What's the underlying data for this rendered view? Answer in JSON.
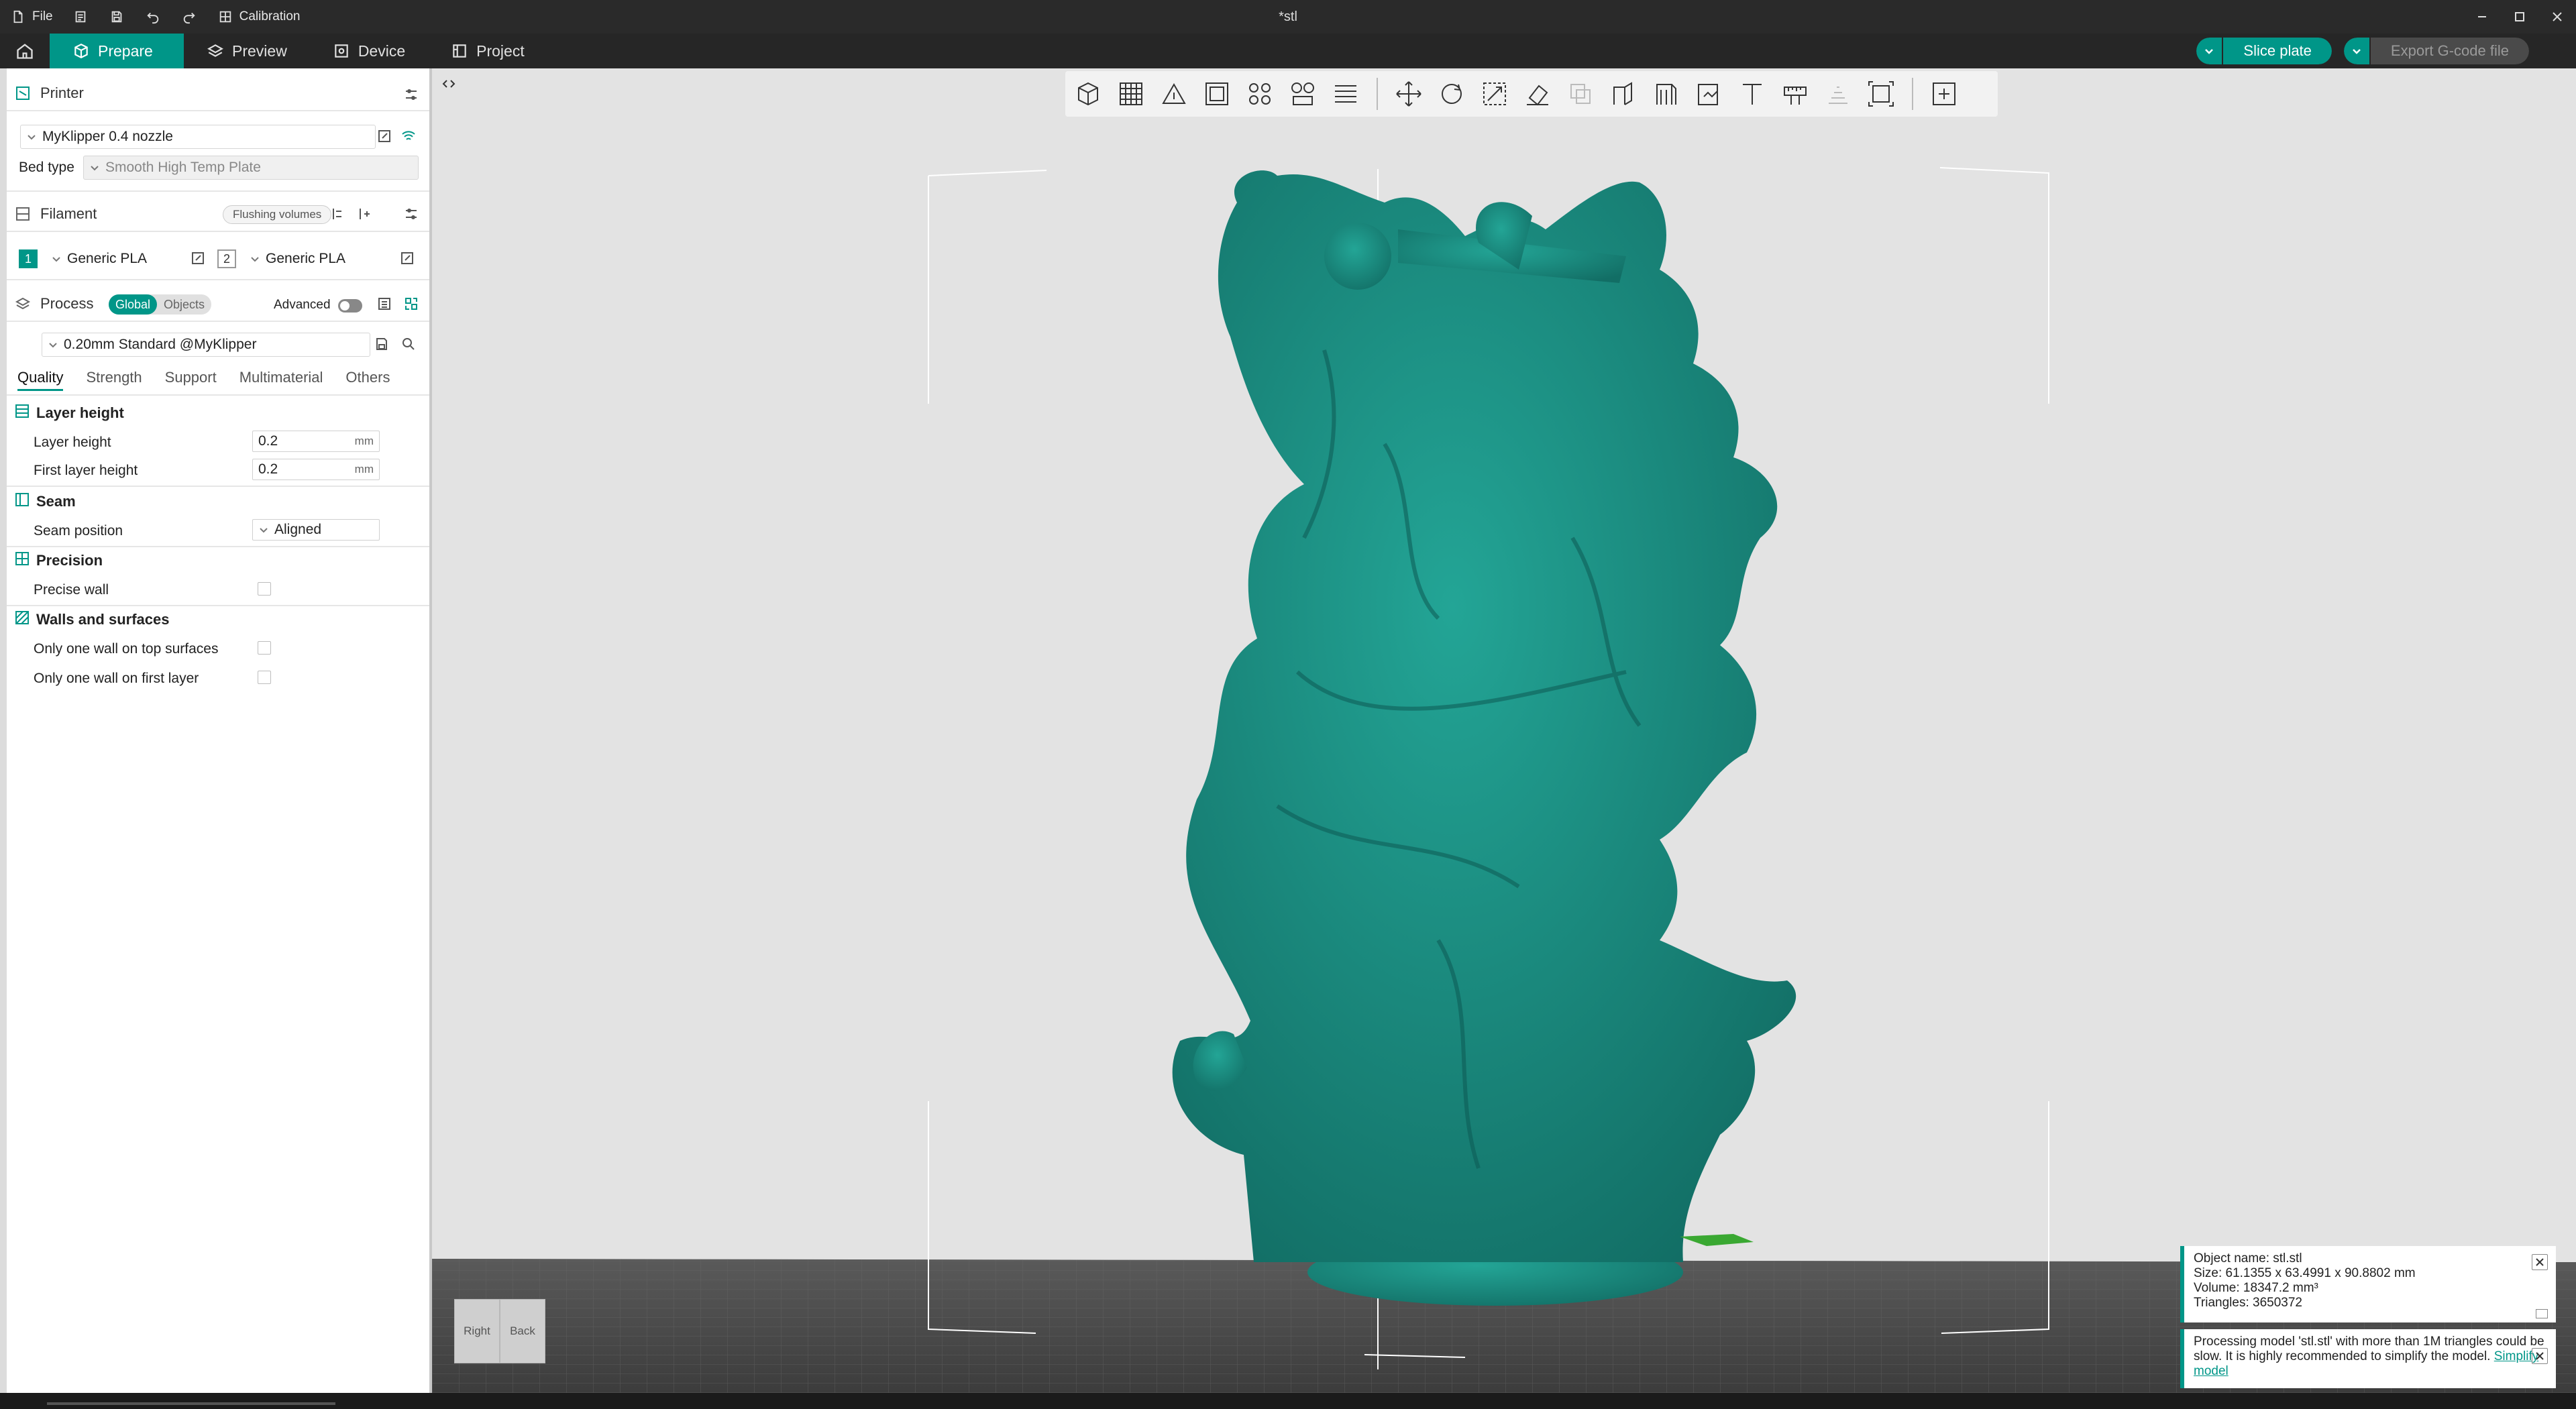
{
  "titlebar": {
    "file_label": "File",
    "calibration_label": "Calibration",
    "document_title": "*stl"
  },
  "nav": {
    "tabs": [
      {
        "label": "Prepare",
        "icon": "cube-icon",
        "active": true
      },
      {
        "label": "Preview",
        "icon": "layers-icon",
        "active": false
      },
      {
        "label": "Device",
        "icon": "device-icon",
        "active": false
      },
      {
        "label": "Project",
        "icon": "project-icon",
        "active": false
      }
    ],
    "slice_label": "Slice plate",
    "export_label": "Export G-code file"
  },
  "printer": {
    "section_label": "Printer",
    "name": "MyKlipper 0.4 nozzle",
    "bed_type_label": "Bed type",
    "bed_type_value": "Smooth High Temp Plate"
  },
  "filament": {
    "section_label": "Filament",
    "flushing_label": "Flushing volumes",
    "slots": [
      {
        "number": "1",
        "name": "Generic PLA",
        "color": "#009688"
      },
      {
        "number": "2",
        "name": "Generic PLA",
        "color": "#ffffff"
      }
    ]
  },
  "process": {
    "section_label": "Process",
    "seg_global": "Global",
    "seg_objects": "Objects",
    "advanced_label": "Advanced",
    "advanced_on": false,
    "preset": "0.20mm Standard @MyKlipper",
    "tabs": [
      "Quality",
      "Strength",
      "Support",
      "Multimaterial",
      "Others"
    ],
    "active_tab": "Quality"
  },
  "quality": {
    "layer_height_group": "Layer height",
    "layer_height_label": "Layer height",
    "layer_height_value": "0.2",
    "first_layer_height_label": "First layer height",
    "first_layer_height_value": "0.2",
    "unit_mm": "mm",
    "seam_group": "Seam",
    "seam_position_label": "Seam position",
    "seam_position_value": "Aligned",
    "precision_group": "Precision",
    "precise_wall_label": "Precise wall",
    "precise_wall_checked": false,
    "walls_group": "Walls and surfaces",
    "one_wall_top_label": "Only one wall on top surfaces",
    "one_wall_top_checked": false,
    "one_wall_first_label": "Only one wall on first layer",
    "one_wall_first_checked": false
  },
  "viewport": {
    "model_color": "#1a8f84",
    "view_cube_right": "Right",
    "view_cube_back": "Back",
    "toolbar_icons": [
      "add-object-icon",
      "arrange-grid-icon",
      "orient-icon",
      "plate-icon",
      "auto-arrange-icon",
      "split-icon",
      "layers-list-icon",
      "move-icon",
      "rotate-icon",
      "scale-icon",
      "lay-on-face-icon",
      "mesh-boolean-icon",
      "cut-icon",
      "support-paint-icon",
      "seam-paint-icon",
      "text-icon",
      "measure-icon",
      "assembly-icon",
      "fit-view-icon",
      "explode-icon"
    ]
  },
  "info": {
    "object_name": "Object name: stl.stl",
    "size": "Size: 61.1355 x 63.4991 x 90.8802 mm",
    "volume": "Volume: 18347.2 mm³",
    "triangles": "Triangles: 3650372"
  },
  "notice": {
    "text": "Processing model 'stl.stl' with more than 1M triangles could be slow. It is highly recommended to simplify the model.",
    "link": "Simplify model"
  }
}
